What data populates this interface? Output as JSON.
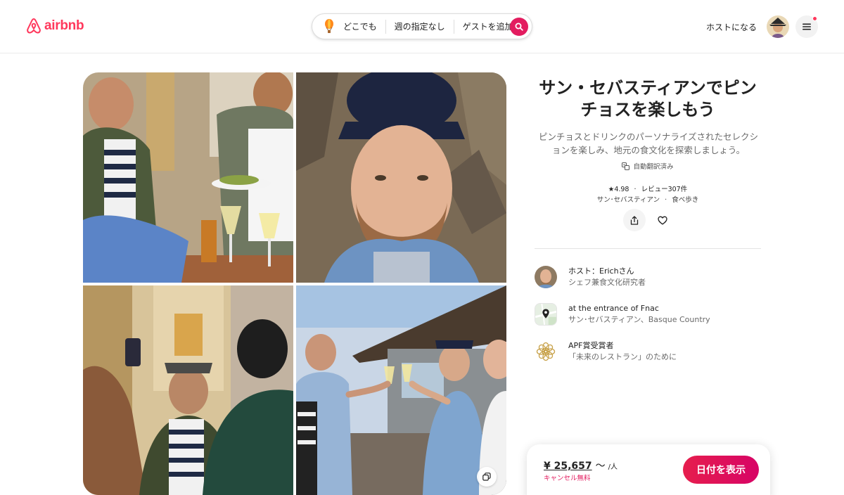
{
  "header": {
    "logo_text": "airbnb",
    "search": {
      "where": "どこでも",
      "when": "週の指定なし",
      "who": "ゲストを追加"
    },
    "become_host": "ホストになる"
  },
  "gallery": {
    "photos": [
      {
        "name": "friends-sharing-pintxos",
        "icon": "photo"
      },
      {
        "name": "host-portrait",
        "icon": "photo"
      },
      {
        "name": "host-on-old-town-street",
        "icon": "photo"
      },
      {
        "name": "group-toast",
        "icon": "photo"
      }
    ]
  },
  "experience": {
    "title": "サン・セバスティアンでピンチョスを楽しもう",
    "description": "ピンチョスとドリンクのパーソナライズされたセレクションを楽しみ、地元の食文化を探索しましょう。",
    "translated_label": "自動翻訳済み",
    "rating": "★4.98",
    "reviews": "レビュー307件",
    "dot": "·",
    "city": "サン･セバスティアン",
    "category": "食べ歩き"
  },
  "info_rows": {
    "host": {
      "primary": "ホスト：Erichさん",
      "secondary": "シェフ兼食文化研究者"
    },
    "meeting": {
      "primary": "at the entrance of Fnac",
      "secondary": "サン･セバスティアン、Basque Country"
    },
    "award": {
      "primary": "APF賞受賞者",
      "secondary": "「未来のレストラン」のために"
    }
  },
  "booking": {
    "price": "¥ 25,657",
    "tilde": "〜",
    "unit": "/人",
    "cancellation": "キャンセル無料",
    "cta": "日付を表示"
  },
  "colors": {
    "brand": "#ff385c",
    "cta": "#e31c5f",
    "text": "#222222",
    "muted": "#6a6a6a"
  }
}
